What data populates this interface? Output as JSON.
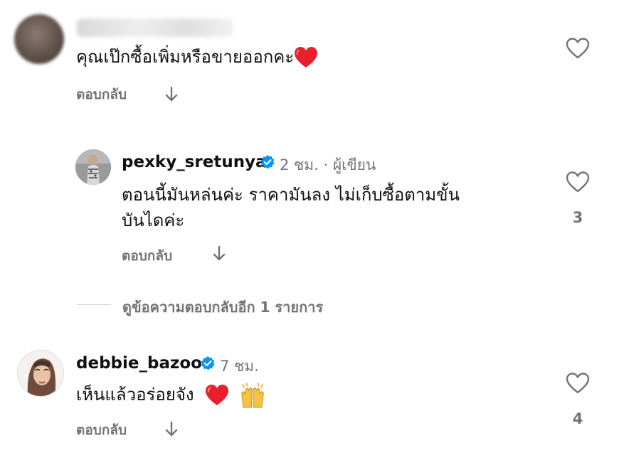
{
  "comments": [
    {
      "username": "",
      "time": "",
      "text": "คุณเป๊กซื้อเพิ่มหรือขายออกคะ",
      "emojis": [
        "red-heart"
      ],
      "reply_label": "ตอบกลับ",
      "likes": ""
    },
    {
      "username": "pexky_sretunya",
      "verified": true,
      "time": "2 ชม. · ผู้เขียน",
      "text_lines": [
        "ตอนนี้มันหล่นค่ะ ราคามันลง ไม่เก็บซื้อตามขั้น",
        "บันไดค่ะ"
      ],
      "reply_label": "ตอบกลับ",
      "likes": "3"
    },
    {
      "username": "debbie_bazoo",
      "verified": true,
      "time": "7 ชม.",
      "text": "เห็นแล้วอร่อยจัง",
      "emojis": [
        "red-heart",
        "raising-hands"
      ],
      "reply_label": "ตอบกลับ",
      "likes": "4"
    }
  ],
  "view_more_replies": "ดูข้อความตอบกลับอีก 1 รายการ",
  "colors": {
    "verified": "#0095f6",
    "heart_emoji": "#e8202e",
    "muted": "#737373"
  }
}
